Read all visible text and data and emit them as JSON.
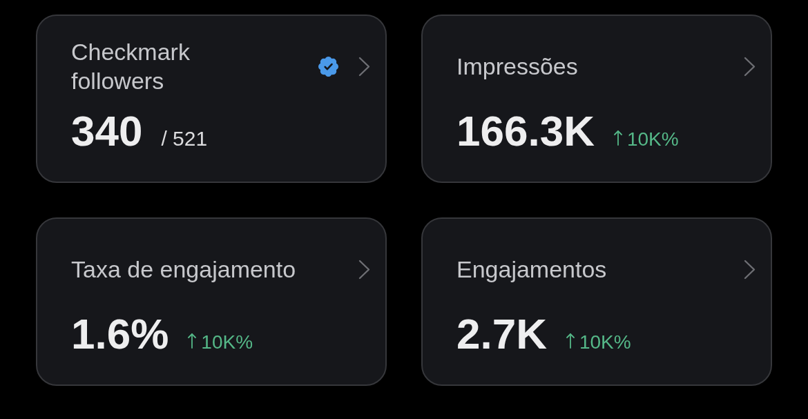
{
  "cards": [
    {
      "title": "Checkmark followers",
      "verified": true,
      "value": "340",
      "total": "/ 521"
    },
    {
      "title": "Impressões",
      "verified": false,
      "value": "166.3K",
      "change": {
        "kind": "up",
        "text": "10K%"
      }
    },
    {
      "title": "Taxa de engajamento",
      "verified": false,
      "value": "1.6%",
      "change": {
        "kind": "up",
        "text": "10K%"
      }
    },
    {
      "title": "Engajamentos",
      "verified": false,
      "value": "2.7K",
      "change": {
        "kind": "up",
        "text": "10K%"
      }
    }
  ]
}
